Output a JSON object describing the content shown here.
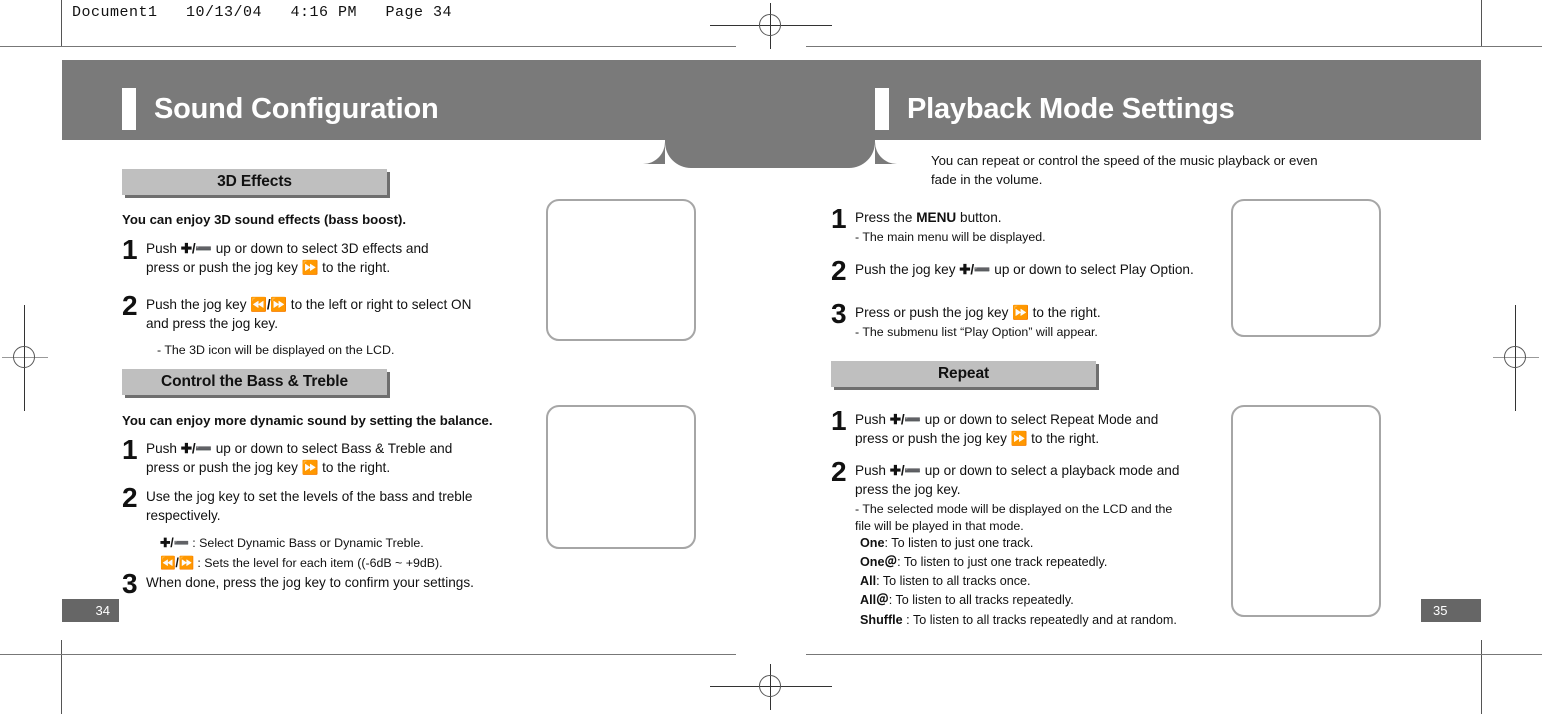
{
  "print": {
    "header_line": "Document1   10/13/04   4:16 PM   Page 34"
  },
  "left_page": {
    "chapter_title": "Sound Configuration",
    "folio": "34",
    "sections": [
      {
        "chip_label": "3D Effects",
        "intro": "You can enjoy 3D sound effects (bass boost).",
        "steps": [
          {
            "number": "1",
            "line1_pre": "Push ",
            "line1_glyph": "✚/➖",
            "line1_post": " up or down to select 3D effects and",
            "line2_pre": "press or push the jog key ",
            "line2_glyph": "⏩",
            "line2_post": " to the right."
          },
          {
            "number": "2",
            "line1_pre": "Push the jog key ",
            "line1_glyph": "⏪/⏩",
            "line1_post": " to the left or right to select ON",
            "line2": "and press the jog key.",
            "note": "- The 3D icon will be displayed on the LCD."
          }
        ]
      },
      {
        "chip_label": "Control the Bass & Treble",
        "intro": "You can enjoy more dynamic sound by setting the balance.",
        "steps": [
          {
            "number": "1",
            "line1_pre": "Push ",
            "line1_glyph": "✚/➖",
            "line1_post": " up or down to select Bass & Treble and",
            "line2_pre": "press or push the jog key ",
            "line2_glyph": "⏩",
            "line2_post": " to the right."
          },
          {
            "number": "2",
            "line1": "Use the jog key to set the levels of the bass and treble",
            "line2": "respectively.",
            "bullets": [
              {
                "glyph": "✚/➖",
                "text": " : Select Dynamic Bass or Dynamic Treble."
              },
              {
                "glyph": "⏪/⏩",
                "text": " : Sets the level for each item ((-6dB ~ +9dB)."
              }
            ]
          },
          {
            "number": "3",
            "line1": "When done, press the jog key to confirm your settings."
          }
        ]
      }
    ]
  },
  "right_page": {
    "chapter_title": "Playback Mode Settings",
    "folio": "35",
    "intro_line1": "You can repeat or control the speed of the music playback or even",
    "intro_line2": "fade in the volume.",
    "top_steps": [
      {
        "number": "1",
        "pre": "Press the ",
        "bold": "MENU",
        "post": " button.",
        "note": "- The main menu will be displayed."
      },
      {
        "number": "2",
        "pre": "Push the jog key ",
        "glyph": "✚/➖",
        "post": " up or down to select Play Option."
      },
      {
        "number": "3",
        "pre": "Press or push the jog key ",
        "glyph": "⏩",
        "post": " to the right.",
        "note": "- The submenu list “Play Option” will appear."
      }
    ],
    "repeat_section": {
      "chip_label": "Repeat",
      "steps": [
        {
          "number": "1",
          "line1_pre": "Push ",
          "line1_glyph": "✚/➖",
          "line1_post": " up or down to select Repeat Mode and",
          "line2_pre": "press or push the jog key ",
          "line2_glyph": "⏩",
          "line2_post": " to the right."
        },
        {
          "number": "2",
          "line1_pre": "Push ",
          "line1_glyph": "✚/➖",
          "line1_post": " up or down to select a playback mode and",
          "line2": "press the jog key.",
          "note1": "- The selected mode will be displayed on the LCD and the",
          "note2": "file will be played in that mode."
        }
      ],
      "modes": [
        {
          "name": "One",
          "desc": ": To listen to just one track."
        },
        {
          "name": "One＠",
          "desc": ": To listen to just one track repeatedly."
        },
        {
          "name": "All",
          "desc": ": To listen to all tracks once."
        },
        {
          "name": "All＠",
          "desc": ": To listen to all tracks repeatedly."
        },
        {
          "name": "Shuffle",
          "desc": " : To listen to all tracks repeatedly and at random."
        }
      ]
    }
  },
  "colors": {
    "band_gray": "#7a7a7a",
    "chip_gray": "#bfbfbf",
    "chip_shadow": "#6f6f6f",
    "folio_gray": "#666666",
    "art_border": "#a6a6a6"
  }
}
